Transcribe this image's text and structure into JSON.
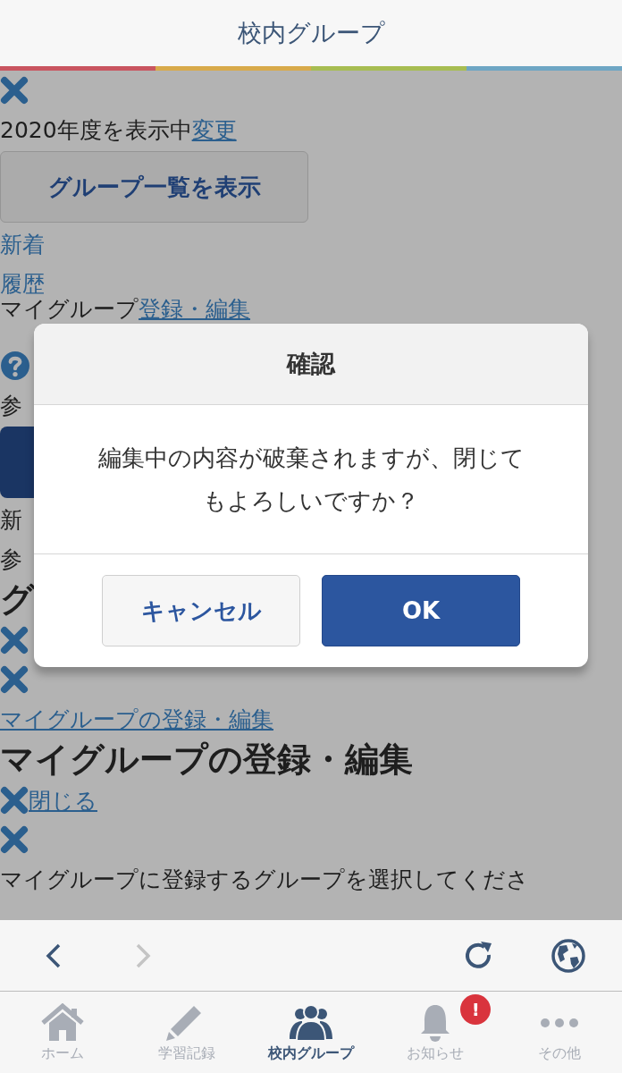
{
  "header": {
    "title": "校内グループ"
  },
  "lines": [
    {
      "kind": "close"
    },
    {
      "kind": "text",
      "text": "2020年度を表示中",
      "link": "変更"
    },
    {
      "kind": "button",
      "label": "グループ一覧を表示"
    },
    {
      "kind": "link",
      "text": "新着"
    },
    {
      "kind": "link",
      "text": "履歴"
    },
    {
      "kind": "text",
      "text": "マイグループ",
      "link": "登録・編集"
    },
    {
      "kind": "help"
    },
    {
      "kind": "text",
      "text": "参"
    },
    {
      "kind": "dark_button"
    },
    {
      "kind": "text",
      "text": "新"
    },
    {
      "kind": "text",
      "text": "参"
    },
    {
      "kind": "heading",
      "text": "グ"
    },
    {
      "kind": "close"
    },
    {
      "kind": "close"
    },
    {
      "kind": "link",
      "text": "マイグループの登録・編集"
    },
    {
      "kind": "heading",
      "text": "マイグループの登録・編集"
    },
    {
      "kind": "close",
      "link": "閉じる"
    },
    {
      "kind": "close"
    },
    {
      "kind": "text",
      "text": "マイグループに登録するグループを選択してくださ"
    }
  ],
  "dialog": {
    "title": "確認",
    "message": "編集中の内容が破棄されますが、閉じてもよろしいですか？",
    "buttons": [
      {
        "kind": "cancel",
        "label": "キャンセル"
      },
      {
        "kind": "ok",
        "label": "OK"
      }
    ]
  },
  "browser_bar": {
    "back_disabled": false,
    "forward_disabled": true
  },
  "tabs": [
    {
      "kind": "home",
      "label": "ホーム",
      "selected": false
    },
    {
      "kind": "pencil",
      "label": "学習記録",
      "selected": false
    },
    {
      "kind": "group",
      "label": "校内グループ",
      "selected": true
    },
    {
      "kind": "bell",
      "label": "お知らせ",
      "selected": false,
      "badge": "!"
    },
    {
      "kind": "more",
      "label": "その他",
      "selected": false
    }
  ]
}
